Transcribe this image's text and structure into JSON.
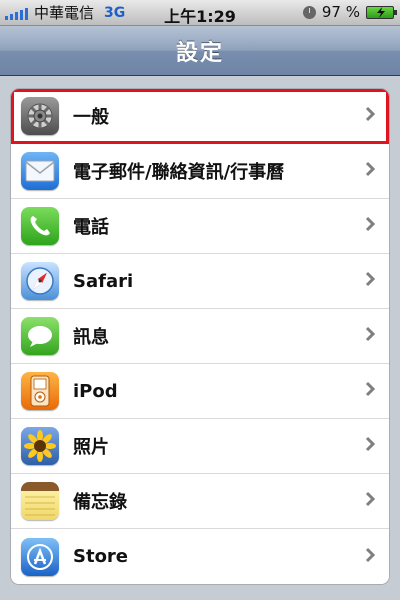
{
  "status_bar": {
    "carrier": "中華電信",
    "network": "3G",
    "time": "上午1:29",
    "battery_percent": "97 %",
    "signal_bars": 5
  },
  "nav": {
    "title": "設定"
  },
  "settings": {
    "items": [
      {
        "label": "一般",
        "icon": "gear-icon",
        "selected": true
      },
      {
        "label": "電子郵件/聯絡資訊/行事曆",
        "icon": "mail-icon",
        "selected": false
      },
      {
        "label": "電話",
        "icon": "phone-icon",
        "selected": false
      },
      {
        "label": "Safari",
        "icon": "compass-icon",
        "selected": false
      },
      {
        "label": "訊息",
        "icon": "speech-bubble-icon",
        "selected": false
      },
      {
        "label": "iPod",
        "icon": "ipod-icon",
        "selected": false
      },
      {
        "label": "照片",
        "icon": "sunflower-icon",
        "selected": false
      },
      {
        "label": "備忘錄",
        "icon": "notepad-icon",
        "selected": false
      },
      {
        "label": "Store",
        "icon": "app-store-icon",
        "selected": false
      }
    ]
  },
  "colors": {
    "selection_outline": "#e0141e",
    "nav_bar": "#7a8fae",
    "background": "#c5ccd4"
  }
}
